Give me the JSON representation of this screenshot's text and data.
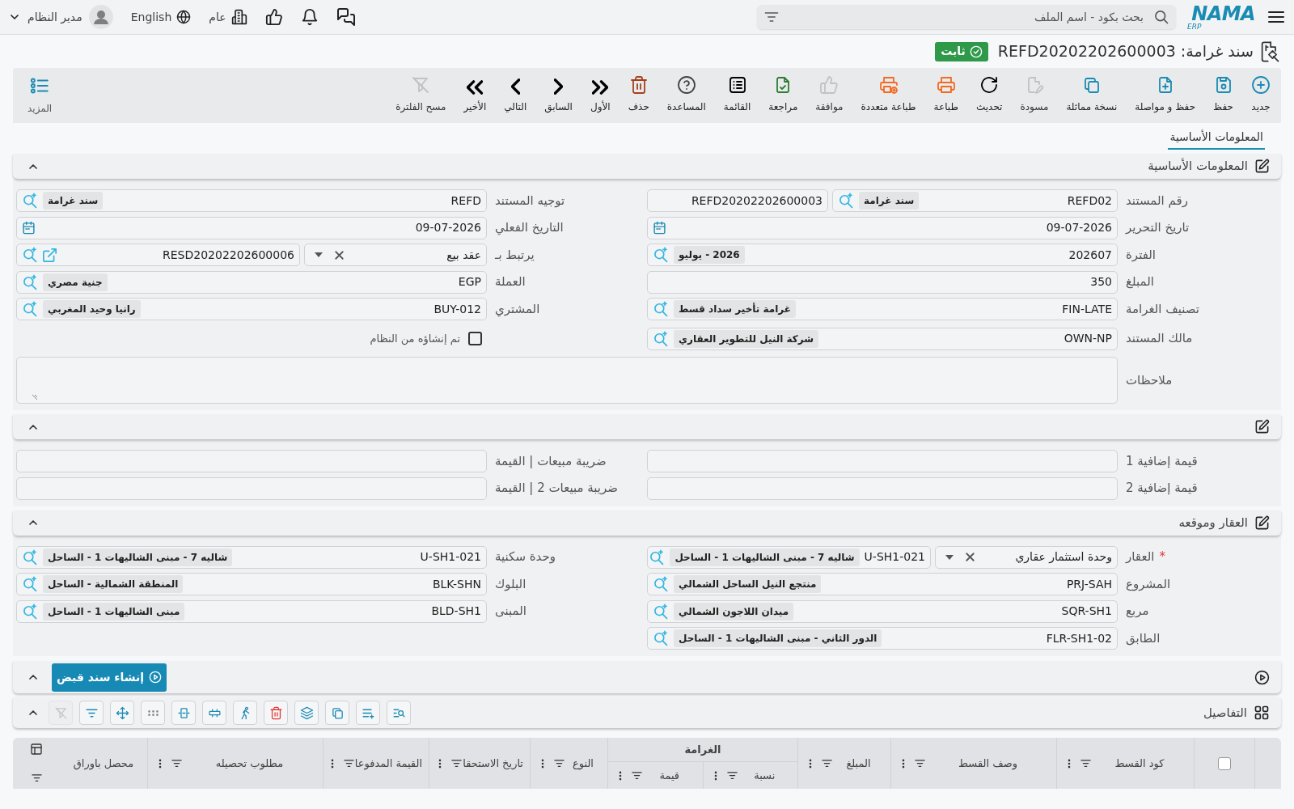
{
  "topbar": {
    "logo": {
      "name": "NAMA",
      "sub": "ERP"
    },
    "search": {
      "placeholder": "بحث بكود - اسم الملف"
    },
    "company": "عام",
    "language": "English",
    "user": "مدير النظام"
  },
  "title": {
    "text": "سند غرامة: REFD20202202600003",
    "status": "ثابت"
  },
  "toolbar": [
    {
      "kind": "new",
      "label": "جديد",
      "disabled": false
    },
    {
      "kind": "save",
      "label": "حفظ",
      "disabled": false
    },
    {
      "kind": "save_continue",
      "label": "حفظ و مواصلة",
      "disabled": false
    },
    {
      "kind": "duplicate",
      "label": "نسخة مماثلة",
      "disabled": false
    },
    {
      "kind": "draft",
      "label": "مسودة",
      "disabled": true
    },
    {
      "kind": "refresh",
      "label": "تحديث",
      "disabled": false
    },
    {
      "kind": "print",
      "label": "طباعة",
      "disabled": false
    },
    {
      "kind": "print_multi",
      "label": "طباعة متعددة",
      "disabled": false
    },
    {
      "kind": "approve",
      "label": "موافقة",
      "disabled": true
    },
    {
      "kind": "review",
      "label": "مراجعة",
      "disabled": false
    },
    {
      "kind": "list",
      "label": "القائمة",
      "disabled": false
    },
    {
      "kind": "help",
      "label": "المساعدة",
      "disabled": false
    },
    {
      "kind": "delete",
      "label": "حذف",
      "disabled": false
    },
    {
      "kind": "first",
      "label": "الأول",
      "disabled": false
    },
    {
      "kind": "previous",
      "label": "السابق",
      "disabled": false
    },
    {
      "kind": "next",
      "label": "التالي",
      "disabled": false
    },
    {
      "kind": "last",
      "label": "الأخير",
      "disabled": false
    },
    {
      "kind": "clear_filter",
      "label": "مسح الفلترة",
      "disabled": true
    }
  ],
  "more": {
    "label": "المزيد"
  },
  "tabs": [
    {
      "label": "المعلومات الأساسية",
      "selected": true
    }
  ],
  "sections": [
    {
      "kind": "form",
      "title": "المعلومات الأساسية",
      "expanded": true,
      "fields": [
        {
          "kind": "lookup",
          "label": "رقم المستند",
          "value": "REFD02",
          "chip": "سند غرامة",
          "extra": "REFD20202202600003"
        },
        {
          "kind": "lookup",
          "label": "توجيه المستند",
          "value": "REFD",
          "chip": "سند غرامة"
        },
        {
          "kind": "date",
          "label": "تاريخ التحرير",
          "value": "09-07-2026"
        },
        {
          "kind": "date",
          "label": "التاريخ الفعلي",
          "value": "09-07-2026"
        },
        {
          "kind": "lookup",
          "label": "الفترة",
          "value": "202607",
          "chip": "2026 - يوليو"
        },
        {
          "kind": "select_lookup",
          "label": "يرتبط بـ",
          "select": "عقد بيع",
          "value": "RESD20202202600006",
          "link": true
        },
        {
          "kind": "text",
          "label": "المبلغ",
          "value": "350"
        },
        {
          "kind": "lookup",
          "label": "العملة",
          "value": "EGP",
          "chip": "جنية مصري"
        },
        {
          "kind": "lookup",
          "label": "تصنيف الغرامة",
          "value": "FIN-LATE",
          "chip": "غرامة تأخير سداد قسط"
        },
        {
          "kind": "lookup",
          "label": "المشتري",
          "value": "BUY-012",
          "chip": "رانيا وحيد المغربي"
        },
        {
          "kind": "lookup",
          "label": "مالك المستند",
          "value": "OWN-NP",
          "chip": "شركة النيل للتطوير العقاري"
        },
        {
          "kind": "checkbox",
          "text": "تم إنشاؤه من النظام",
          "checked": false
        },
        {
          "kind": "textarea",
          "label": "ملاحظات"
        }
      ]
    },
    {
      "kind": "form",
      "expanded": true,
      "fields": [
        {
          "kind": "text",
          "label": "قيمة إضافية 1"
        },
        {
          "kind": "text",
          "label": "ضريبة مبيعات | القيمة"
        },
        {
          "kind": "text",
          "label": "قيمة إضافية 2"
        },
        {
          "kind": "text",
          "label": "ضريبة مبيعات 2 | القيمة"
        }
      ]
    },
    {
      "kind": "form",
      "title": "العقار وموقعه",
      "expanded": true,
      "fields": [
        {
          "kind": "select_lookup",
          "label": "العقار",
          "required_mark": "*",
          "select": "وحدة استثمار عقاري",
          "value": "U-SH1-021",
          "chip": "شاليه 7 - مبنى الشاليهات 1 - الساحل"
        },
        {
          "kind": "lookup",
          "label": "وحدة سكنية",
          "value": "U-SH1-021",
          "chip": "شاليه 7 - مبنى الشاليهات 1 - الساحل"
        },
        {
          "kind": "lookup",
          "label": "المشروع",
          "value": "PRJ-SAH",
          "chip": "منتجع النيل الساحل الشمالي"
        },
        {
          "kind": "lookup",
          "label": "البلوك",
          "value": "BLK-SHN",
          "chip": "المنطقة الشمالية - الساحل"
        },
        {
          "kind": "lookup",
          "label": "مربع",
          "value": "SQR-SH1",
          "chip": "ميدان اللاجون الشمالي"
        },
        {
          "kind": "lookup",
          "label": "المبنى",
          "value": "BLD-SH1",
          "chip": "مبنى الشاليهات 1 - الساحل"
        },
        {
          "kind": "lookup",
          "label": "الطابق",
          "value": "FLR-SH1-02",
          "chip": "الدور الثاني - مبنى الشاليهات 1 - الساحل"
        }
      ]
    },
    {
      "kind": "actions",
      "expanded": true,
      "button": {
        "label": "إنشاء سند قبض"
      }
    },
    {
      "kind": "grid",
      "title": "التفاصيل",
      "expanded": true,
      "tools": [
        {
          "kind": "find",
          "disabled": false
        },
        {
          "kind": "add_row",
          "disabled": false
        },
        {
          "kind": "copy",
          "disabled": false
        },
        {
          "kind": "layers",
          "disabled": false
        },
        {
          "kind": "delete",
          "disabled": false
        },
        {
          "kind": "run",
          "disabled": false
        },
        {
          "kind": "rows",
          "disabled": false
        },
        {
          "kind": "fit",
          "disabled": false
        },
        {
          "kind": "dots",
          "disabled": false
        },
        {
          "kind": "move",
          "disabled": false
        },
        {
          "kind": "filter",
          "disabled": false
        },
        {
          "kind": "clear_filter",
          "disabled": true
        }
      ],
      "select_all": {
        "checked": false
      },
      "columns": [
        {
          "label": "كود القسط"
        },
        {
          "label": "وصف القسط"
        },
        {
          "label": "المبلغ"
        },
        {
          "label": "الغرامة",
          "children": [
            {
              "label": "نسبة"
            },
            {
              "label": "قيمة"
            }
          ]
        },
        {
          "label": "النوع"
        },
        {
          "label": "تاريخ الاستحقا"
        },
        {
          "label": "القيمة المدفوعا"
        },
        {
          "label": "مطلوب تحصيله"
        },
        {
          "label": "محصل باوراق"
        }
      ]
    }
  ]
}
